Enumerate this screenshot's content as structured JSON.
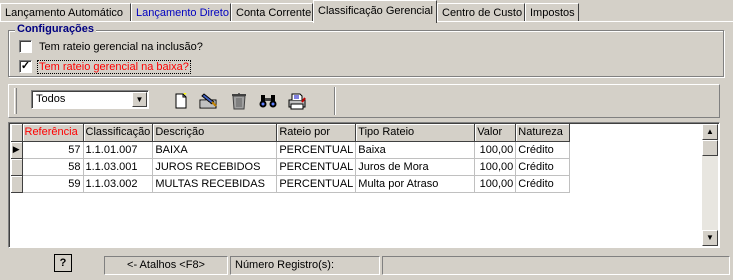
{
  "tabs": [
    {
      "label": "Lançamento Automático",
      "color": "black"
    },
    {
      "label": "Lançamento Direto",
      "color": "blue"
    },
    {
      "label": "Conta Corrente",
      "color": "black"
    },
    {
      "label": "Classificação Gerencial",
      "color": "black",
      "active": true
    },
    {
      "label": "Centro de Custo",
      "color": "black"
    },
    {
      "label": "Impostos",
      "color": "black"
    }
  ],
  "config": {
    "title": "Configurações",
    "options": [
      {
        "label": "Tem rateio gerencial na inclusão?",
        "checked": false
      },
      {
        "label": "Tem rateio gerencial na baixa?",
        "checked": true
      }
    ]
  },
  "toolbar": {
    "filter_value": "Todos",
    "buttons": [
      "new-document-icon",
      "edit-icon",
      "delete-icon",
      "search-binoculars-icon",
      "print-icon"
    ]
  },
  "grid": {
    "columns": [
      "Referência",
      "Classificação",
      "Descrição",
      "Rateio por",
      "Tipo Rateio",
      "Valor",
      "Natureza"
    ],
    "rows": [
      [
        "57",
        "1.1.01.007",
        "BAIXA",
        "PERCENTUAL",
        "Baixa",
        "100,00",
        "Crédito"
      ],
      [
        "58",
        "1.1.03.001",
        "JUROS RECEBIDOS",
        "PERCENTUAL",
        "Juros de Mora",
        "100,00",
        "Crédito"
      ],
      [
        "59",
        "1.1.03.002",
        "MULTAS RECEBIDAS",
        "PERCENTUAL",
        "Multa por Atraso",
        "100,00",
        "Crédito"
      ]
    ]
  },
  "status": {
    "help_icon": "?",
    "shortcuts": "<- Atalhos <F8>",
    "record_count_label": "Número Registro(s):"
  },
  "colors": {
    "sorted_header": "#ff0000",
    "link_tab": "#0000c0",
    "group_title": "#000080"
  }
}
